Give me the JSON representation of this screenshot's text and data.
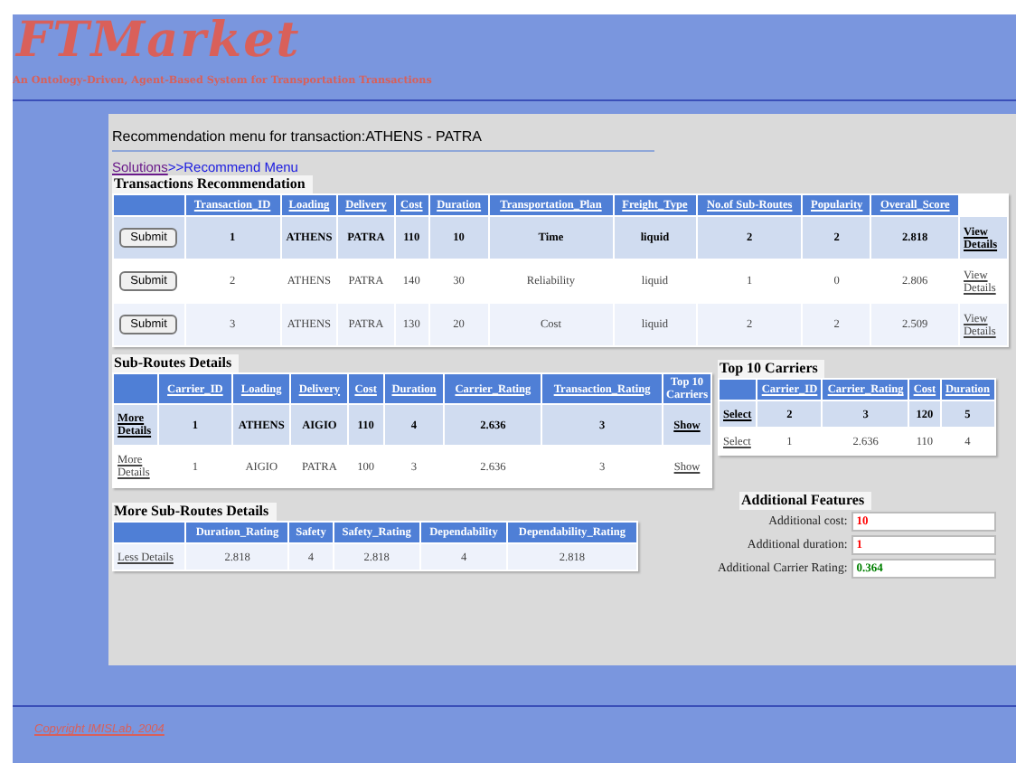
{
  "header": {
    "title": "FTMarket",
    "subtitle": "An Ontology-Driven, Agent-Based System for Transportation Transactions"
  },
  "panel": {
    "heading": "Recommendation menu for transaction:ATHENS - PATRA",
    "breadcrumb": {
      "link": "Solutions",
      "current": ">>Recommend Menu"
    }
  },
  "transactions": {
    "title": "Transactions Recommendation",
    "sortable": true,
    "columns": [
      "Transaction_ID",
      "Loading",
      "Delivery",
      "Cost",
      "Duration",
      "Transportation_Plan",
      "Freight_Type",
      "No.of Sub-Routes",
      "Popularity",
      "Overall_Score"
    ],
    "rows": [
      {
        "selected": true,
        "action": "Submit",
        "cells": [
          "1",
          "ATHENS",
          "PATRA",
          "110",
          "10",
          "Time",
          "liquid",
          "2",
          "2",
          "2.818"
        ],
        "link": "View Details"
      },
      {
        "selected": false,
        "action": "Submit",
        "cells": [
          "2",
          "ATHENS",
          "PATRA",
          "140",
          "30",
          "Reliability",
          "liquid",
          "1",
          "0",
          "2.806"
        ],
        "link": "View Details"
      },
      {
        "selected": false,
        "action": "Submit",
        "cells": [
          "3",
          "ATHENS",
          "PATRA",
          "130",
          "20",
          "Cost",
          "liquid",
          "2",
          "2",
          "2.509"
        ],
        "link": "View Details"
      }
    ]
  },
  "sub_routes": {
    "title": "Sub-Routes Details",
    "sortable": true,
    "columns": [
      "Carrier_ID",
      "Loading",
      "Delivery",
      "Cost",
      "Duration",
      "Carrier_Rating",
      "Transaction_Rating"
    ],
    "extra_column": "Top 10 Carriers",
    "rows": [
      {
        "selected": true,
        "link": "More Details",
        "cells": [
          "1",
          "ATHENS",
          "AIGIO",
          "110",
          "4",
          "2.636",
          "3"
        ],
        "action": "Show"
      },
      {
        "selected": false,
        "link": "More Details",
        "cells": [
          "1",
          "AIGIO",
          "PATRA",
          "100",
          "3",
          "2.636",
          "3"
        ],
        "action": "Show"
      }
    ]
  },
  "top_carriers": {
    "title": "Top 10 Carriers",
    "sortable": true,
    "columns": [
      "Carrier_ID",
      "Carrier_Rating",
      "Cost",
      "Duration"
    ],
    "rows": [
      {
        "selected": true,
        "link": "Select",
        "cells": [
          "2",
          "3",
          "120",
          "5"
        ]
      },
      {
        "selected": false,
        "link": "Select",
        "cells": [
          "1",
          "2.636",
          "110",
          "4"
        ]
      }
    ]
  },
  "more_sub_routes": {
    "title": "More Sub-Routes Details",
    "sortable": false,
    "columns": [
      "Duration_Rating",
      "Safety",
      "Safety_Rating",
      "Dependability",
      "Dependability_Rating"
    ],
    "rows": [
      {
        "link": "Less Details",
        "cells": [
          "2.818",
          "4",
          "2.818",
          "4",
          "2.818"
        ]
      }
    ]
  },
  "additional_features": {
    "title": "Additional Features",
    "fields": [
      {
        "label": "Additional cost:",
        "value": "10",
        "color": "#ff0000"
      },
      {
        "label": "Additional duration:",
        "value": "1",
        "color": "#ff0000"
      },
      {
        "label": "Additional Carrier Rating:",
        "value": "0.364",
        "color": "#008000"
      }
    ]
  },
  "footer": {
    "copyright": "Copyright IMISLab, 2004"
  }
}
